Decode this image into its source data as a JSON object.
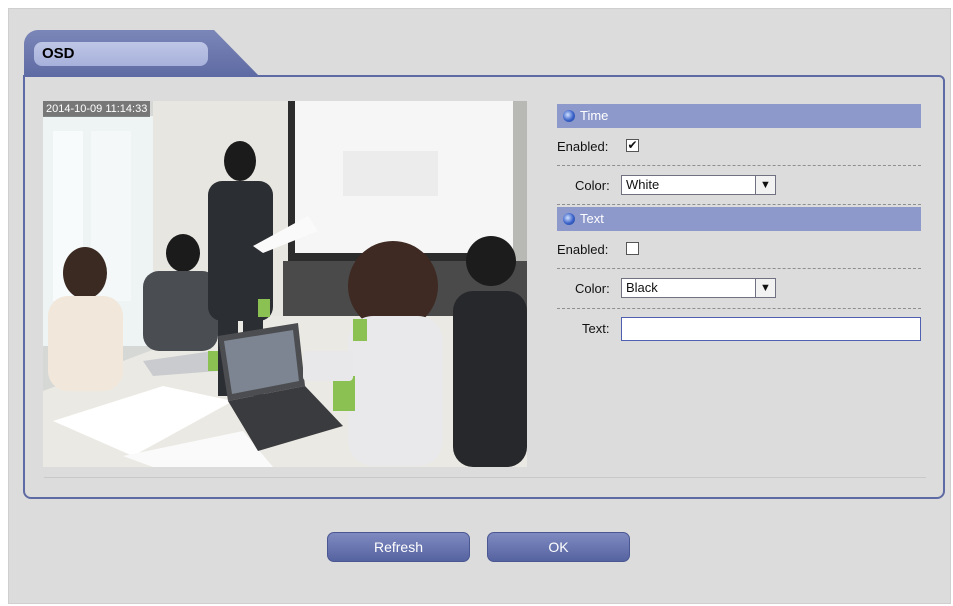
{
  "panel": {
    "title": "OSD"
  },
  "video": {
    "timestamp": "2014-10-09 11:14:33"
  },
  "time_section": {
    "header": "Time",
    "enabled_label": "Enabled:",
    "enabled_mark": "✔",
    "enabled": true,
    "color_label": "Color:",
    "color_value": "White"
  },
  "text_section": {
    "header": "Text",
    "enabled_label": "Enabled:",
    "enabled": false,
    "color_label": "Color:",
    "color_value": "Black",
    "text_label": "Text:",
    "text_value": ""
  },
  "buttons": {
    "refresh": "Refresh",
    "ok": "OK"
  },
  "icons": {
    "section_dot": "circle-bullet-icon",
    "dropdown": "chevron-down-icon",
    "check": "checkmark-icon"
  },
  "colors": {
    "accent": "#5e6aa3",
    "header_bg": "#8d99cb",
    "panel_bg": "#dcdcdc"
  }
}
